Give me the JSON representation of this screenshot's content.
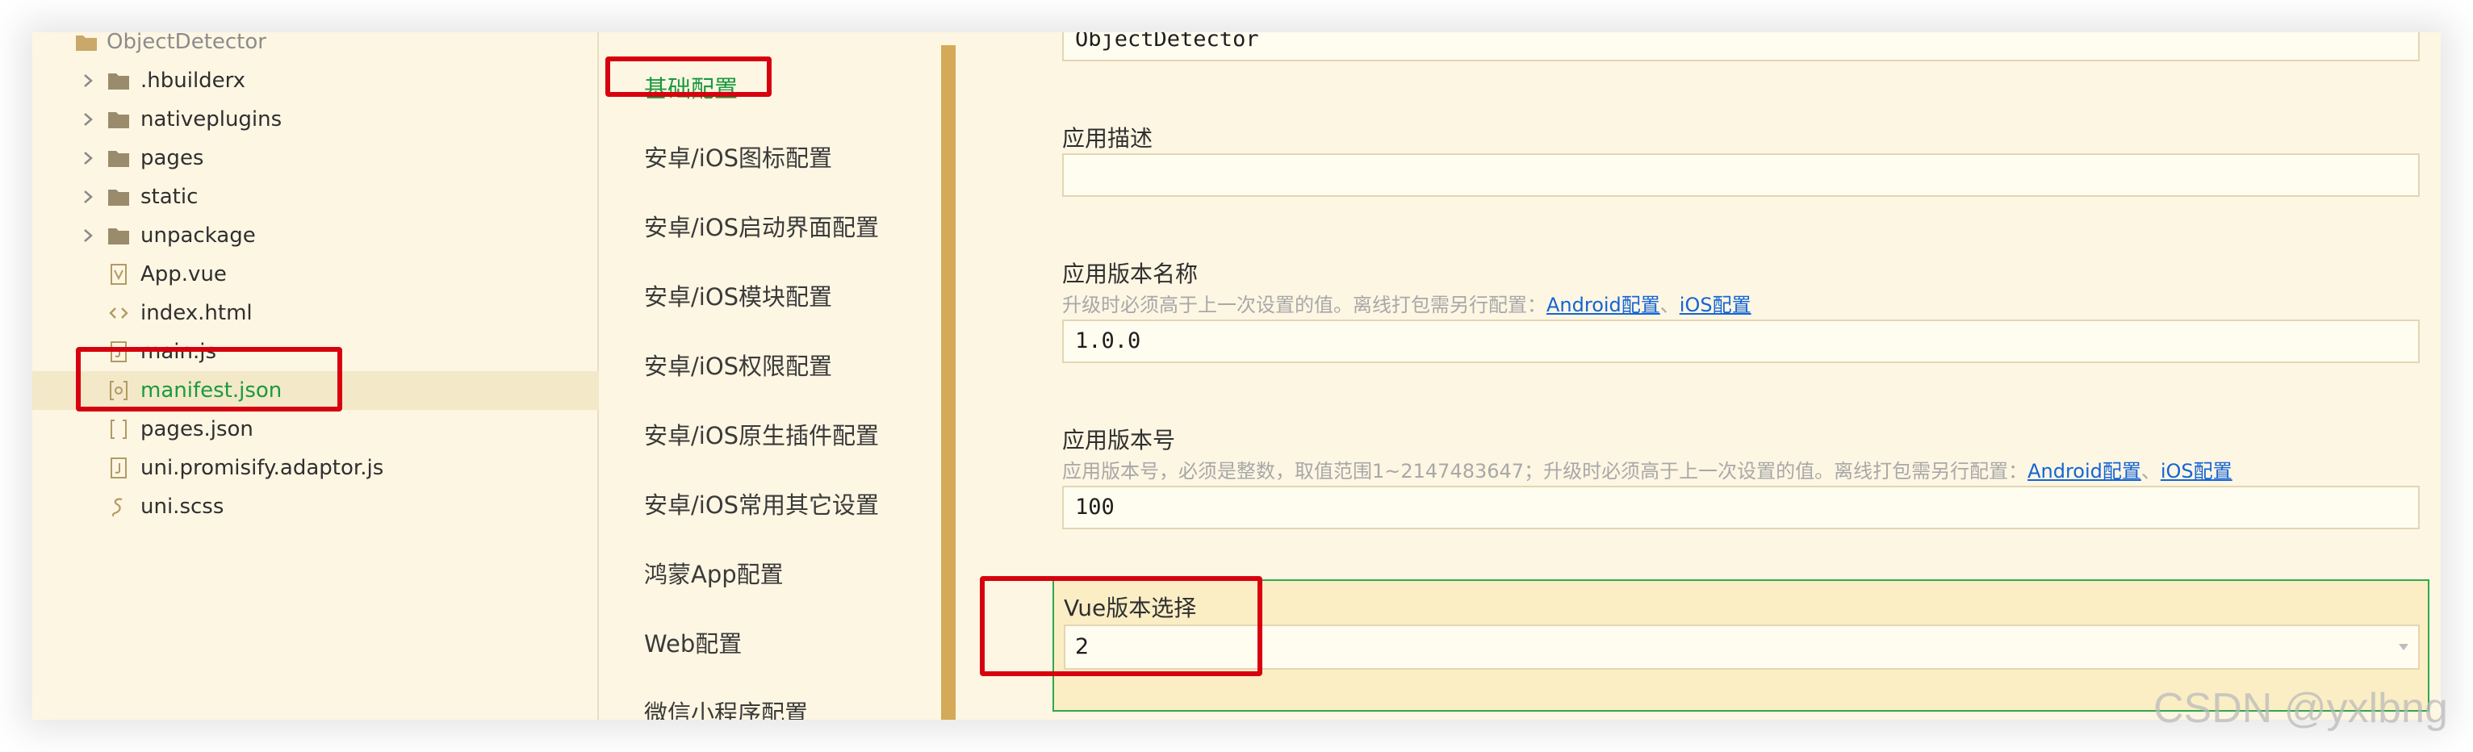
{
  "tree": {
    "root": "ObjectDetector",
    "items": [
      {
        "name": ".hbuilderx",
        "icon": "folder-icon"
      },
      {
        "name": "nativeplugins",
        "icon": "folder-icon"
      },
      {
        "name": "pages",
        "icon": "folder-icon"
      },
      {
        "name": "static",
        "icon": "folder-icon"
      },
      {
        "name": "unpackage",
        "icon": "folder-icon"
      },
      {
        "name": "App.vue",
        "icon": "vue-file-icon"
      },
      {
        "name": "index.html",
        "icon": "html-file-icon"
      },
      {
        "name": "main.js",
        "icon": "js-file-icon"
      },
      {
        "name": "manifest.json",
        "icon": "manifest-file-icon",
        "selected": true
      },
      {
        "name": "pages.json",
        "icon": "json-file-icon"
      },
      {
        "name": "uni.promisify.adaptor.js",
        "icon": "js-file-icon"
      },
      {
        "name": "uni.scss",
        "icon": "scss-file-icon"
      }
    ]
  },
  "nav": {
    "items": [
      {
        "label": "基础配置",
        "active": true
      },
      {
        "label": "安卓/iOS图标配置"
      },
      {
        "label": "安卓/iOS启动界面配置"
      },
      {
        "label": "安卓/iOS模块配置"
      },
      {
        "label": "安卓/iOS权限配置"
      },
      {
        "label": "安卓/iOS原生插件配置"
      },
      {
        "label": "安卓/iOS常用其它设置"
      },
      {
        "label": "鸿蒙App配置"
      },
      {
        "label": "Web配置"
      },
      {
        "label": "微信小程序配置"
      }
    ]
  },
  "form": {
    "app_name_value": "ObjectDetector",
    "description": {
      "label": "应用描述",
      "value": ""
    },
    "version_name": {
      "label": "应用版本名称",
      "hint": "升级时必须高于上一次设置的值。离线打包需另行配置：",
      "link1": "Android配置",
      "sep": "、",
      "link2": "iOS配置",
      "value": "1.0.0"
    },
    "version_code": {
      "label": "应用版本号",
      "hint": "应用版本号，必须是整数，取值范围1~2147483647；升级时必须高于上一次设置的值。离线打包需另行配置：",
      "link1": "Android配置",
      "sep": "、",
      "link2": "iOS配置",
      "value": "100"
    },
    "vue_version": {
      "label": "Vue版本选择",
      "value": "2"
    }
  },
  "watermark": "CSDN @yxlbng",
  "colors": {
    "background": "#fdf6e3",
    "accent_green": "#1a9a3e",
    "nav_bar": "#d4aa58",
    "annotation_red": "#d7000f",
    "link_blue": "#1464d6"
  }
}
